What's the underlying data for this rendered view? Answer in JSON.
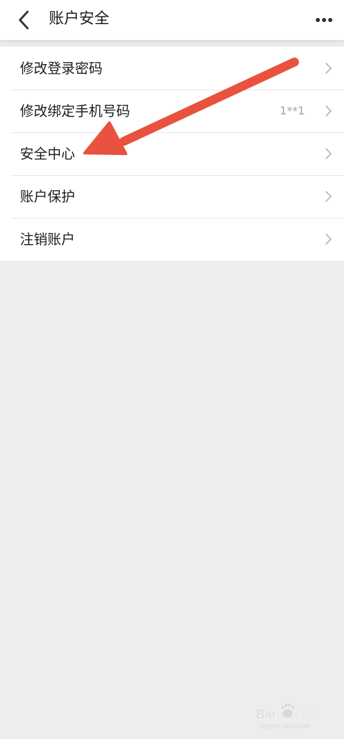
{
  "header": {
    "title": "账户安全",
    "back_icon": "chevron-left-icon",
    "more_icon": "more-horizontal-icon"
  },
  "menu": {
    "items": [
      {
        "label": "修改登录密码",
        "value": "",
        "icon": "chevron-right-icon"
      },
      {
        "label": "修改绑定手机号码",
        "value": "1**1",
        "icon": "chevron-right-icon"
      },
      {
        "label": "安全中心",
        "value": "",
        "icon": "chevron-right-icon"
      },
      {
        "label": "账户保护",
        "value": "",
        "icon": "chevron-right-icon"
      },
      {
        "label": "注销账户",
        "value": "",
        "icon": "chevron-right-icon"
      }
    ]
  },
  "annotation": {
    "icon": "red-arrow",
    "color": "#e8523f"
  },
  "watermark": {
    "brand": "Baidu 经验",
    "url": "jingyan.baidu.com"
  },
  "colors": {
    "background": "#ededef",
    "surface": "#ffffff",
    "text_primary": "#1d1d1f",
    "text_secondary": "#a3a3a6",
    "chevron": "#b5b5b8",
    "accent_arrow": "#e8523f"
  }
}
